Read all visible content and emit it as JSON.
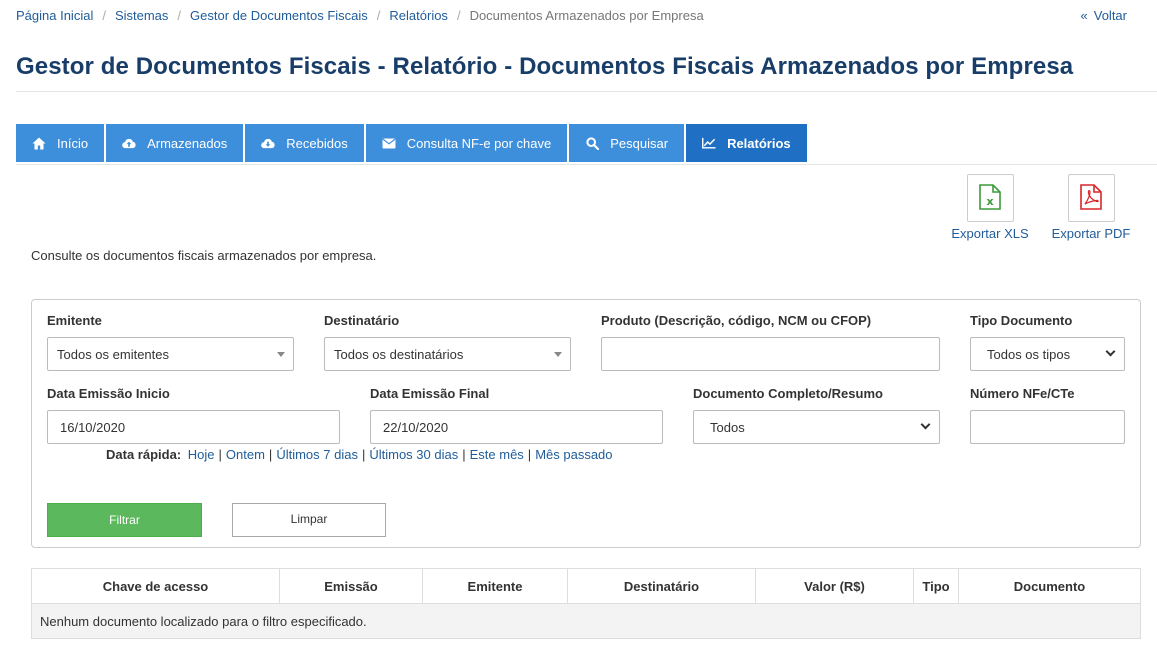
{
  "breadcrumb": {
    "items": [
      "Página Inicial",
      "Sistemas",
      "Gestor de Documentos Fiscais",
      "Relatórios"
    ],
    "current": "Documentos Armazenados por Empresa"
  },
  "back_label": "Voltar",
  "page_title": "Gestor de Documentos Fiscais - Relatório - Documentos Fiscais Armazenados por Empresa",
  "tabs": [
    {
      "label": "Início",
      "icon": "home-icon"
    },
    {
      "label": "Armazenados",
      "icon": "cloud-upload-icon"
    },
    {
      "label": "Recebidos",
      "icon": "cloud-download-icon"
    },
    {
      "label": "Consulta NF-e por chave",
      "icon": "envelope-icon"
    },
    {
      "label": "Pesquisar",
      "icon": "search-icon"
    },
    {
      "label": "Relatórios",
      "icon": "line-chart-icon",
      "active": true
    }
  ],
  "export": {
    "xls_label": "Exportar XLS",
    "pdf_label": "Exportar PDF",
    "xls_color": "#3c9a3c",
    "pdf_color": "#d9262a"
  },
  "intro": "Consulte os documentos fiscais armazenados por empresa.",
  "filters": {
    "emitente": {
      "label": "Emitente",
      "value": "Todos os emitentes"
    },
    "destinatario": {
      "label": "Destinatário",
      "value": "Todos os destinatários"
    },
    "produto": {
      "label": "Produto (Descrição, código, NCM ou CFOP)",
      "value": ""
    },
    "tipo_documento": {
      "label": "Tipo Documento",
      "value": "Todos os tipos"
    },
    "data_inicio": {
      "label": "Data Emissão Inicio",
      "value": "16/10/2020"
    },
    "data_final": {
      "label": "Data Emissão Final",
      "value": "22/10/2020"
    },
    "completo_resumo": {
      "label": "Documento Completo/Resumo",
      "value": "Todos"
    },
    "numero": {
      "label": "Número NFe/CTe",
      "value": ""
    }
  },
  "quick_dates": {
    "label": "Data rápida:",
    "links": [
      "Hoje",
      "Ontem",
      "Últimos 7 dias",
      "Últimos 30 dias",
      "Este mês",
      "Mês passado"
    ]
  },
  "buttons": {
    "filter": "Filtrar",
    "clear": "Limpar"
  },
  "table": {
    "columns": [
      "Chave de acesso",
      "Emissão",
      "Emitente",
      "Destinatário",
      "Valor (R$)",
      "Tipo",
      "Documento"
    ],
    "empty_message": "Nenhum documento localizado para o filtro especificado."
  },
  "colors": {
    "tab": "#3d8fdc",
    "tab_active": "#1f70c4",
    "title": "#183d68",
    "filter_button": "#5cb85c"
  }
}
